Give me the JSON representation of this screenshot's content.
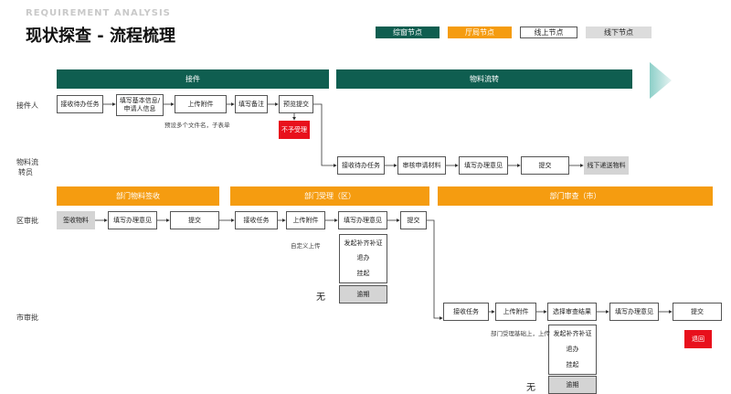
{
  "header": {
    "overline": "REQUIREMENT ANALYSIS",
    "title": "现状探查 - 流程梳理"
  },
  "legend": {
    "window": "综窗节点",
    "office": "厅局节点",
    "online": "线上节点",
    "offline": "线下节点"
  },
  "colors": {
    "green": "#0f5e50",
    "orange": "#f59c10",
    "red": "#e8101c",
    "grey": "#d4d4d4"
  },
  "bands": {
    "receive": "接件",
    "material": "物料流转",
    "dept_sign": "部门物料签收",
    "dept_accept": "部门受理（区）",
    "dept_review": "部门审查（市）"
  },
  "lanes": {
    "receiver": "接件人",
    "material_1": "物料流",
    "material_2": "转员",
    "district": "区审批",
    "city": "市审批"
  },
  "nodes": {
    "r1": "接收待办任务",
    "r2a": "填写基本信息/",
    "r2b": "申请人信息",
    "r3": "上传附件",
    "r4": "填写备注",
    "r5": "预览提交",
    "r6": "不予受理",
    "m1": "接收待办任务",
    "m2": "审核申请材料",
    "m3": "填写办理意见",
    "m4": "提交",
    "m5": "线下递送物料",
    "d1": "签收物料",
    "d2": "填写办理意见",
    "d3": "提交",
    "d4": "接收任务",
    "d5": "上传附件",
    "d6": "填写办理意见",
    "d7": "提交",
    "d_opt1": "发起补齐补证",
    "d_opt2": "退办",
    "d_opt3": "挂起",
    "d_opt4": "逾期",
    "c1": "接收任务",
    "c2": "上传附件",
    "c3": "选择审查结果",
    "c4": "填写办理意见",
    "c5": "提交",
    "c6": "退回",
    "c_opt1": "发起补齐补证",
    "c_opt2": "退办",
    "c_opt3": "挂起",
    "c_opt4": "逾期"
  },
  "notes": {
    "r_note": "预设多个文件名，子表单",
    "d_note": "自定义上传",
    "c_note": "部门受理基础上，上传",
    "d_none": "无",
    "c_none": "无"
  }
}
